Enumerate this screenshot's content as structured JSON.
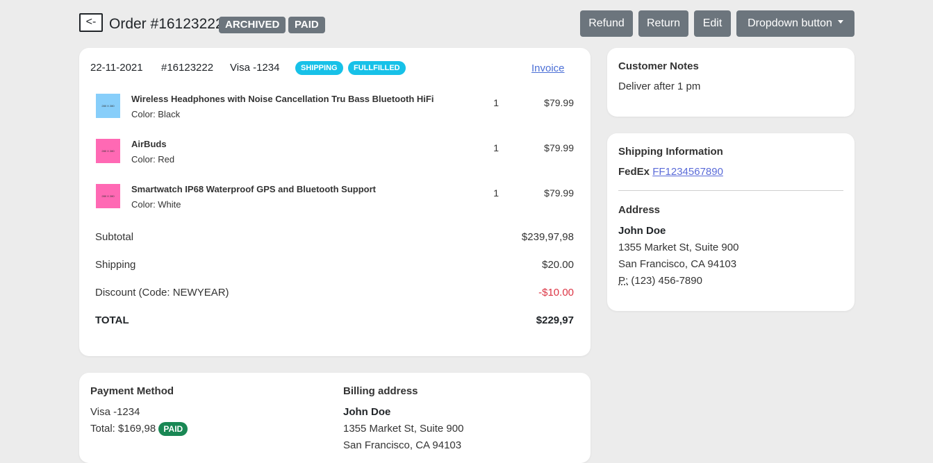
{
  "header": {
    "back_label": "<-",
    "order_title": "Order #16123222",
    "badges": [
      "ARCHIVED",
      "PAID"
    ],
    "buttons": [
      "Refund",
      "Return",
      "Edit",
      "Dropdown button"
    ]
  },
  "order": {
    "date": "22-11-2021",
    "number": "#16123222",
    "payment": "Visa -1234",
    "status_pills": [
      "SHIPPING",
      "FULLFILLED"
    ],
    "invoice_link": "Invoice",
    "items": [
      {
        "thumb_text": "280 X 280",
        "thumb_color": "#87cefa",
        "name": "Wireless Headphones with Noise Cancellation Tru Bass Bluetooth HiFi",
        "variant": "Color: Black",
        "qty": "1",
        "price": "$79.99"
      },
      {
        "thumb_text": "280 X 280",
        "thumb_color": "#ff69b4",
        "name": "AirBuds",
        "variant": "Color: Red",
        "qty": "1",
        "price": "$79.99"
      },
      {
        "thumb_text": "280 X 280",
        "thumb_color": "#ff69b4",
        "name": "Smartwatch IP68 Waterproof GPS and Bluetooth Support",
        "variant": "Color: White",
        "qty": "1",
        "price": "$79.99"
      }
    ],
    "summary": [
      {
        "label": "Subtotal",
        "value": "$239,97,98"
      },
      {
        "label": "Shipping",
        "value": "$20.00"
      },
      {
        "label": "Discount (Code: NEWYEAR)",
        "value": "-$10.00"
      },
      {
        "label": "TOTAL",
        "value": "$229,97"
      }
    ],
    "discount_color": "#dc3545"
  },
  "customer_notes": {
    "title": "Customer Notes",
    "text": "Deliver after 1 pm"
  },
  "shipping": {
    "title": "Shipping Information",
    "carrier": "FedEx",
    "tracking": "FF1234567890",
    "address_title": "Address",
    "name": "John Doe",
    "line1": "1355 Market St, Suite 900",
    "line2": "San Francisco, CA 94103",
    "phone_prefix": "P:",
    "phone": "(123) 456-7890"
  },
  "payment": {
    "title": "Payment Method",
    "method": "Visa -1234",
    "total": "Total: $169,98",
    "badge": "PAID",
    "billing_title": "Billing address",
    "billing_name": "John Doe",
    "billing_line1": "1355 Market St, Suite 900",
    "billing_line2": "San Francisco, CA 94103"
  }
}
